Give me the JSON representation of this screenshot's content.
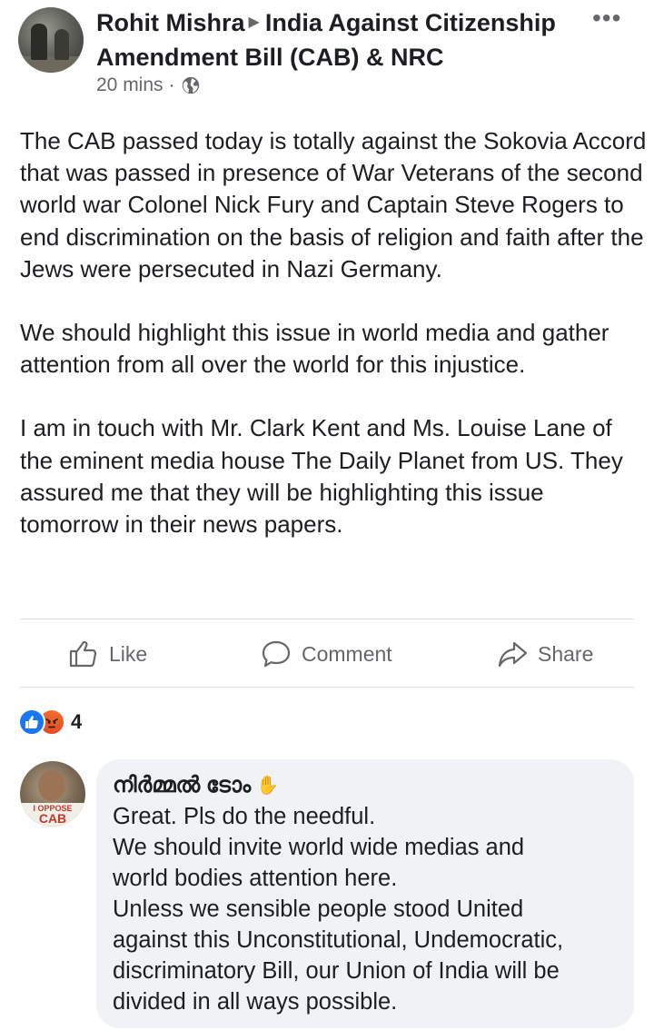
{
  "post": {
    "author": "Rohit Mishra",
    "group": "India Against Citizenship Amendment Bill (CAB) & NRC",
    "time": "20 mins",
    "dot": "·",
    "paragraphs": [
      "The CAB passed today is totally against the Sokovia Accord that was passed in presence of War Veterans of the second world war Colonel Nick Fury and Captain Steve Rogers to end discrimination on the basis of religion and faith after the Jews were persecuted in Nazi Germany.",
      "We should highlight this issue in world media and gather attention from all over the world for this injustice.",
      "I am in touch with Mr. Clark Kent and Ms. Louise Lane of the eminent media house The Daily Planet from US. They assured me that they will be highlighting this issue tomorrow in their news papers."
    ]
  },
  "actions": {
    "like": "Like",
    "comment": "Comment",
    "share": "Share"
  },
  "reactions": {
    "count": "4",
    "types": [
      "like-icon",
      "angry-icon"
    ]
  },
  "comment": {
    "author": "നിർമ്മൽ ടോം",
    "avatar_badge_top": "I OPPOSE",
    "avatar_badge_bottom": "CAB",
    "lines": [
      "Great. Pls do the needful.",
      "We should invite world wide medias and",
      "world bodies attention here.",
      "Unless we sensible people stood United",
      "against this Unconstitutional, Undemocratic,",
      "discriminatory Bill, our Union of India will be",
      "divided in all ways possible."
    ]
  },
  "colors": {
    "text": "#1c1e21",
    "secondary": "#65676b",
    "like_blue": "#1877f2",
    "bubble": "#f0f2f5"
  }
}
